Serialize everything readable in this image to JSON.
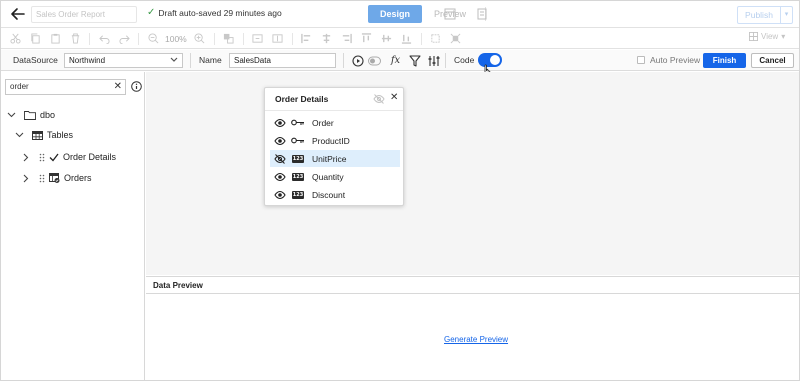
{
  "header": {
    "report_name": "Sales Order Report",
    "autosave_text": "Draft auto-saved 29 minutes ago",
    "modes": [
      "Design",
      "Preview"
    ],
    "publish_label": "Publish"
  },
  "toolbar": {
    "zoom_label": "100%",
    "view_label": "View"
  },
  "properties": {
    "datasource_label": "DataSource",
    "datasource_value": "Northwind",
    "name_label": "Name",
    "name_value": "SalesData",
    "fx_label": "fx",
    "code_label": "Code",
    "code_enabled": true,
    "auto_preview_label": "Auto Preview",
    "auto_preview_checked": false,
    "finish_label": "Finish",
    "cancel_label": "Cancel"
  },
  "left_panel": {
    "search_value": "order",
    "tree": {
      "schema": "dbo",
      "group": "Tables",
      "items": [
        "Order Details",
        "Orders"
      ]
    }
  },
  "popup": {
    "title": "Order Details",
    "type_badge": "123",
    "fields": [
      {
        "name": "Order",
        "type": "key-icon",
        "visible": true,
        "selected": false
      },
      {
        "name": "ProductID",
        "type": "key-icon",
        "visible": true,
        "selected": false
      },
      {
        "name": "UnitPrice",
        "type": "number-icon",
        "visible": false,
        "selected": true
      },
      {
        "name": "Quantity",
        "type": "number-icon",
        "visible": true,
        "selected": false
      },
      {
        "name": "Discount",
        "type": "number-icon",
        "visible": true,
        "selected": false
      }
    ]
  },
  "preview": {
    "title": "Data Preview",
    "generate_label": "Generate Preview"
  },
  "colors": {
    "accent": "#1565e8",
    "design_tab": "#6ea8e8",
    "selected_row": "#deeefc",
    "success": "#3b9b48"
  }
}
